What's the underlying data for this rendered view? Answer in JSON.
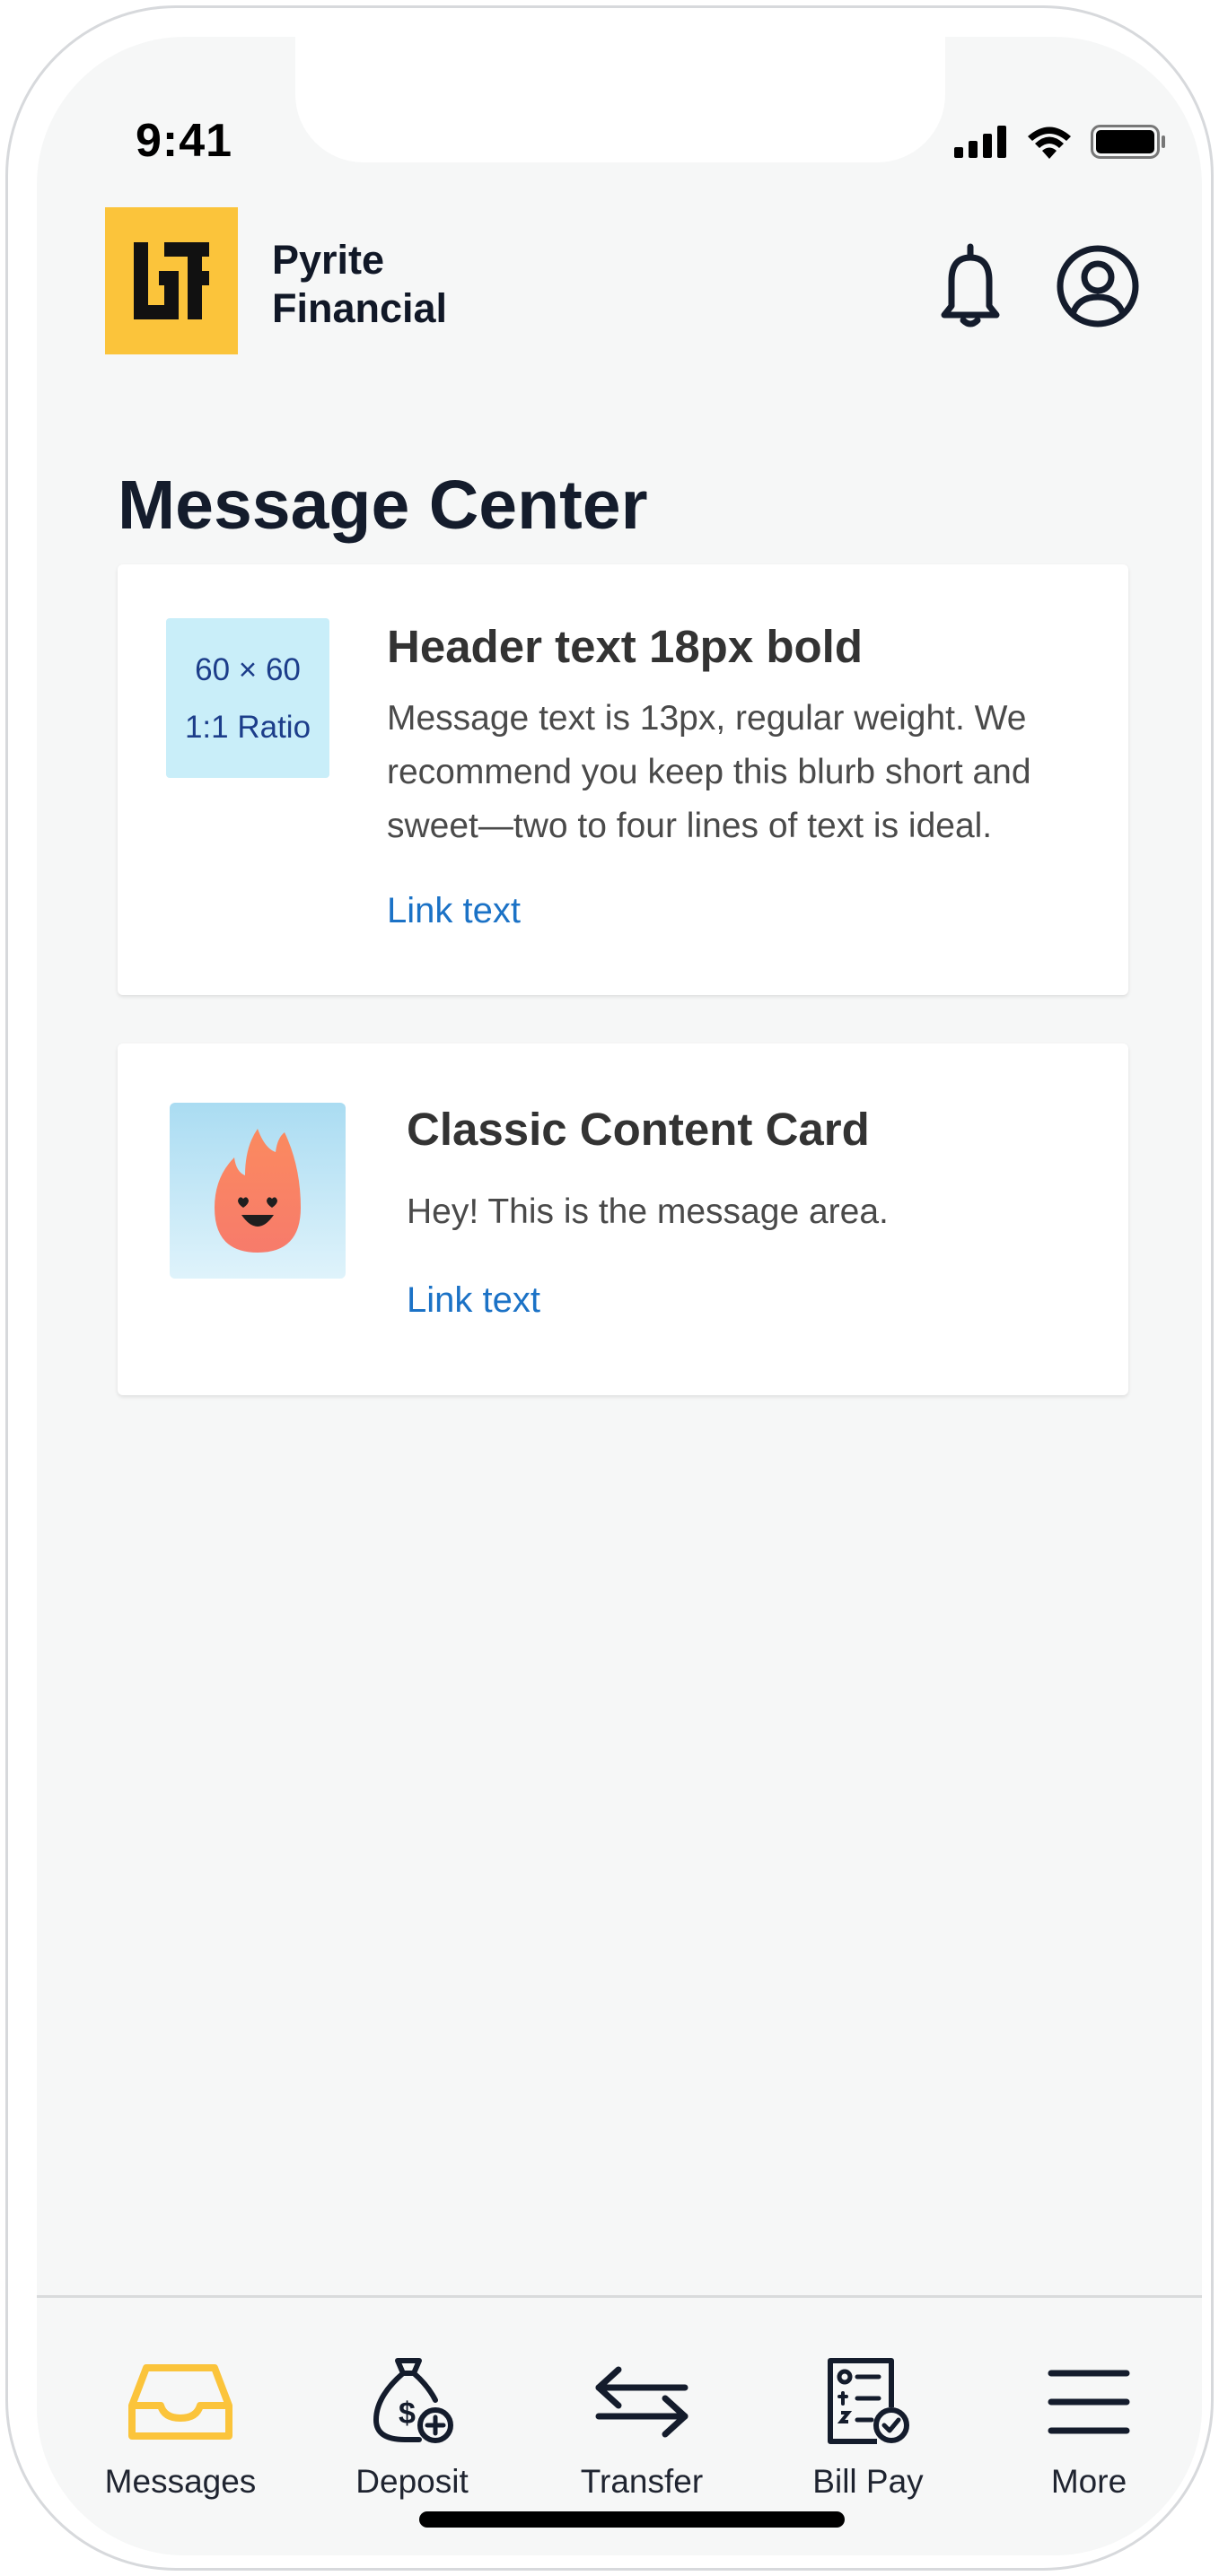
{
  "status_bar": {
    "time": "9:41"
  },
  "brand": {
    "name_line1": "Pyrite",
    "name_line2": "Financial"
  },
  "header": {
    "title": "Message Center"
  },
  "cards": [
    {
      "thumb_line1": "60 × 60",
      "thumb_line2": "1:1 Ratio",
      "title": "Header text 18px bold",
      "message": "Message text is 13px, regular weight. We recommend you keep this blurb short and sweet—two to four lines of text is ideal.",
      "link": "Link text"
    },
    {
      "title": "Classic Content Card",
      "message": "Hey! This is the message area.",
      "link": "Link text"
    }
  ],
  "tabbar": {
    "items": [
      {
        "label": "Messages",
        "icon": "inbox-icon",
        "active": true
      },
      {
        "label": "Deposit",
        "icon": "money-bag-icon"
      },
      {
        "label": "Transfer",
        "icon": "transfer-arrows-icon"
      },
      {
        "label": "Bill Pay",
        "icon": "bill-icon"
      },
      {
        "label": "More",
        "icon": "menu-icon"
      }
    ]
  },
  "colors": {
    "accent": "#fbc43b",
    "link": "#1b72c6",
    "title": "#141c2c",
    "background": "#f6f7f7"
  }
}
